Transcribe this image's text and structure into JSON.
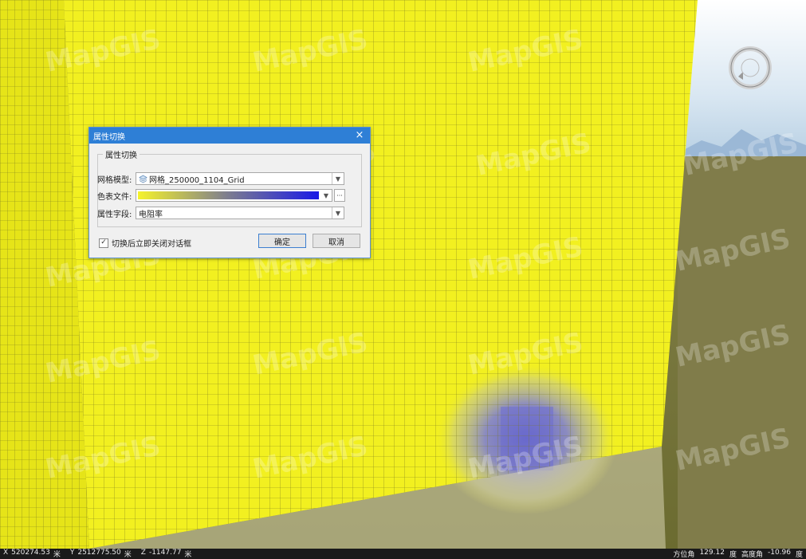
{
  "watermark": "MapGIS",
  "dialog": {
    "title": "属性切换",
    "group_label": "属性切换",
    "grid_model_label": "网格模型:",
    "grid_model_value": "网格_250000_1104_Grid",
    "color_table_label": "色表文件:",
    "attribute_field_label": "属性字段:",
    "attribute_field_value": "电阻率",
    "close_on_switch_label": "切换后立即关闭对话框",
    "close_on_switch_checked": true,
    "ok_label": "确定",
    "cancel_label": "取消",
    "close_glyph": "×",
    "dots_glyph": "···",
    "dropdown_glyph": "▼",
    "check_glyph": "✓"
  },
  "colors": {
    "cube_face": "#f2f020",
    "anomaly": "#6e6ecf",
    "color_table_start": "#f5f32b",
    "color_table_end": "#1a1ae6",
    "titlebar": "#2e7fd6"
  },
  "status": {
    "x_label": "X",
    "x_value": "520274.53",
    "x_unit": "米",
    "y_label": "Y",
    "y_value": "2512775.50",
    "y_unit": "米",
    "z_label": "Z",
    "z_value": "-1147.77",
    "z_unit": "米",
    "azimuth_label": "方位角",
    "azimuth_value": "129.12",
    "azimuth_unit": "度",
    "elevation_label": "高度角",
    "elevation_value": "-10.96",
    "elevation_unit": "度"
  },
  "icons": [
    "compass-icon",
    "grid-model-icon",
    "dropdown-arrow-icon",
    "checkbox-icon",
    "close-icon"
  ]
}
